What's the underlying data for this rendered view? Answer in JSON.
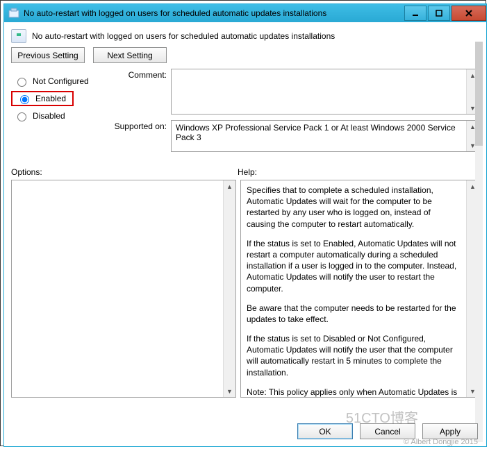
{
  "titlebar": {
    "title": "No auto-restart with logged on users for scheduled automatic updates installations"
  },
  "subtitle": "No auto-restart with logged on users for scheduled automatic updates installations",
  "nav": {
    "prev": "Previous Setting",
    "next": "Next Setting"
  },
  "radios": {
    "not_configured": "Not Configured",
    "enabled": "Enabled",
    "disabled": "Disabled",
    "selected": "enabled"
  },
  "labels": {
    "comment": "Comment:",
    "supported": "Supported on:",
    "options": "Options:",
    "help": "Help:"
  },
  "comment_value": "",
  "supported_text": "Windows XP Professional Service Pack 1 or At least Windows 2000 Service Pack 3",
  "help": {
    "p1": "Specifies that to complete a scheduled installation, Automatic Updates will wait for the computer to be restarted by any user who is logged on, instead of causing the computer to restart automatically.",
    "p2": "If the status is set to Enabled, Automatic Updates will not restart a computer automatically during a scheduled installation if a user is logged in to the computer. Instead, Automatic Updates will notify the user to restart the computer.",
    "p3": "Be aware that the computer needs to be restarted for the updates to take effect.",
    "p4": "If the status is set to Disabled or Not Configured, Automatic Updates will notify the user that the computer will automatically restart in 5 minutes to complete the installation.",
    "p5": "Note: This policy applies only when Automatic Updates is configured to perform scheduled installations of updates. If the"
  },
  "buttons": {
    "ok": "OK",
    "cancel": "Cancel",
    "apply": "Apply"
  },
  "watermark1": "51CTO博客",
  "watermark2": "© Albert Dongjie 2015"
}
